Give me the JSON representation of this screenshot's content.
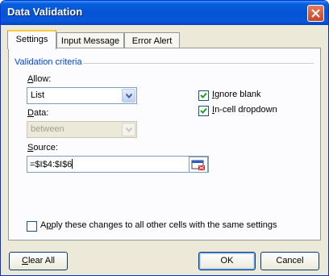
{
  "window": {
    "title": "Data Validation"
  },
  "tabs": [
    {
      "label": "Settings",
      "active": true
    },
    {
      "label": "Input Message",
      "active": false
    },
    {
      "label": "Error Alert",
      "active": false
    }
  ],
  "settings": {
    "group_label": "Validation criteria",
    "allow": {
      "label_key": "A",
      "label_rest": "llow:",
      "value": "List"
    },
    "data": {
      "label_key": "D",
      "label_rest": "ata:",
      "value": "between",
      "disabled": true
    },
    "source": {
      "label_key": "S",
      "label_rest": "ource:",
      "value": "=$I$4:$I$6"
    },
    "ignore_blank": {
      "label_key": "I",
      "label_rest": "gnore blank",
      "checked": true
    },
    "in_cell_dropdown": {
      "label_key": "I",
      "label_rest": "n-cell dropdown",
      "checked": true
    },
    "apply_all": {
      "label_pre": "A",
      "label_key": "p",
      "label_rest": "ply these changes to all other cells with the same settings",
      "checked": false
    }
  },
  "buttons": {
    "clear_all": {
      "label_key": "C",
      "label_rest": "lear All"
    },
    "ok": {
      "label": "OK"
    },
    "cancel": {
      "label": "Cancel"
    }
  },
  "icons": {
    "close": "close-icon",
    "dropdown": "chevron-down-icon",
    "range_select": "collapse-dialog-icon"
  },
  "colors": {
    "title_bar": "#0453d6",
    "group_label": "#0046d5",
    "dialog_bg": "#ece9d8",
    "check": "#21a121"
  }
}
